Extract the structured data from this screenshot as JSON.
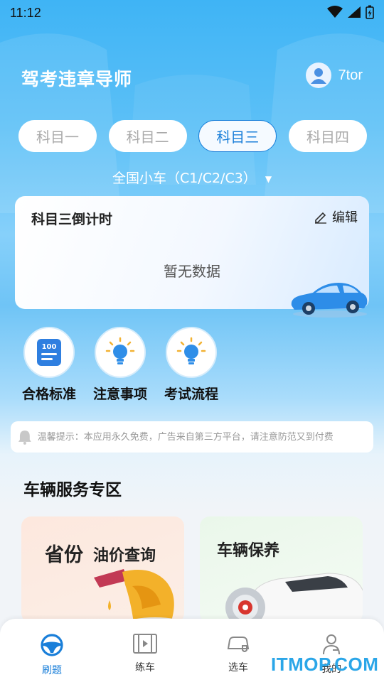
{
  "status_bar": {
    "time": "11:12"
  },
  "header": {
    "title": "驾考违章导师",
    "user_name": "7tor"
  },
  "subject_tabs": [
    {
      "label": "科目一",
      "active": false
    },
    {
      "label": "科目二",
      "active": false
    },
    {
      "label": "科目三",
      "active": true
    },
    {
      "label": "科目四",
      "active": false
    }
  ],
  "vehicle_type": "全国小车（C1/C2/C3）",
  "countdown": {
    "title": "科目三倒计时",
    "edit_label": "编辑",
    "empty_text": "暂无数据"
  },
  "quick_actions": [
    {
      "label": "合格标准",
      "icon": "score-100-icon"
    },
    {
      "label": "注意事项",
      "icon": "lightbulb-icon"
    },
    {
      "label": "考试流程",
      "icon": "lightbulb-icon"
    }
  ],
  "notice": {
    "text": "温馨提示：本应用永久免费，广告来自第三方平台，请注意防范又到付费"
  },
  "vehicle_services": {
    "title": "车辆服务专区",
    "oil": {
      "title": "省份",
      "subtitle": "油价查询"
    },
    "maintenance": {
      "title": "车辆保养"
    }
  },
  "bottom_nav": [
    {
      "label": "刷题",
      "icon": "steering-wheel-icon",
      "active": true
    },
    {
      "label": "练车",
      "icon": "video-icon",
      "active": false
    },
    {
      "label": "选车",
      "icon": "car-select-icon",
      "active": false
    },
    {
      "label": "我的",
      "icon": "profile-icon",
      "active": false
    }
  ],
  "watermark": "ITMOP.COM",
  "colors": {
    "accent": "#1a7fd9",
    "header_bg": "#3fb4f5"
  }
}
